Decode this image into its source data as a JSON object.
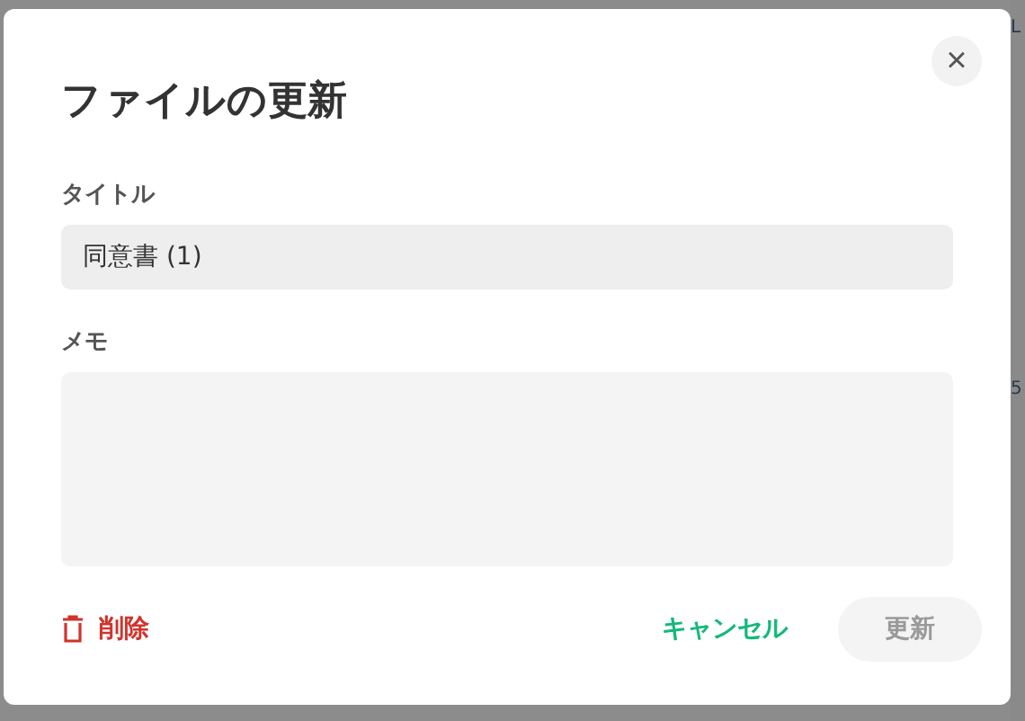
{
  "background": {
    "fragments": [
      "L",
      "5"
    ]
  },
  "dialog": {
    "title": "ファイルの更新",
    "close_label": "×",
    "fields": [
      {
        "label": "タイトル",
        "kind": "text",
        "value": "同意書 (1)"
      },
      {
        "label": "メモ",
        "kind": "textarea"
      }
    ],
    "delete_button": {
      "label": "削除"
    },
    "cancel_button": {
      "label": "キャンセル"
    },
    "submit_button": {
      "label": "更新",
      "disabled": true
    }
  }
}
